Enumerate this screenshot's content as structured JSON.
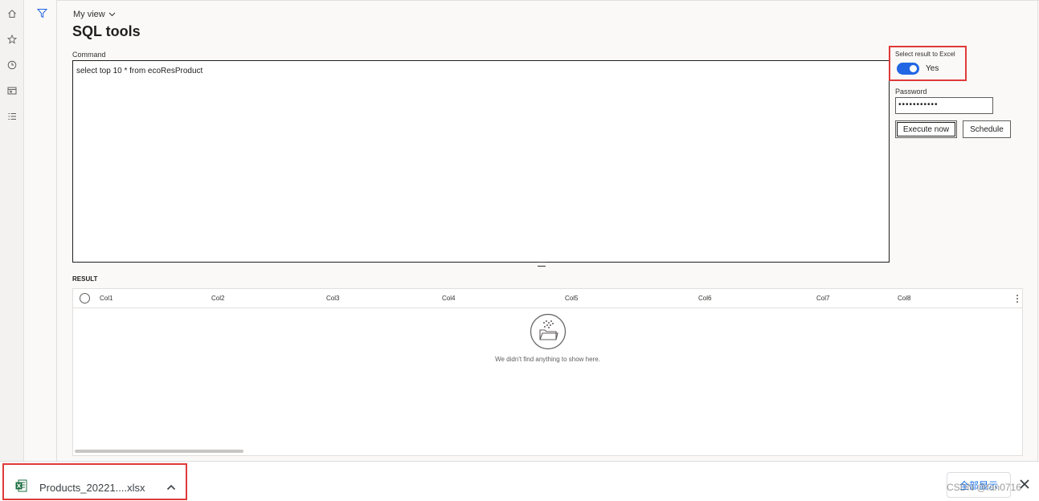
{
  "header": {
    "view_selector": "My view",
    "page_title": "SQL tools"
  },
  "command": {
    "label": "Command",
    "value": "select top 10 * from ecoResProduct"
  },
  "options": {
    "excel_label": "Select result to Excel",
    "excel_toggle_on": true,
    "excel_toggle_text": "Yes",
    "password_label": "Password",
    "password_value": "•••••••••••",
    "execute_button": "Execute now",
    "schedule_button": "Schedule"
  },
  "result": {
    "label": "RESULT",
    "columns": [
      "Col1",
      "Col2",
      "Col3",
      "Col4",
      "Col5",
      "Col6",
      "Col7",
      "Col8"
    ],
    "empty_message": "We didn't find anything to show here."
  },
  "download_bar": {
    "file_name": "Products_20221....xlsx",
    "show_all": "全部显示"
  },
  "watermark": "CSDN @fan0716",
  "colors": {
    "accent": "#2266e3",
    "highlight": "#e03a3a",
    "link": "#1a73e8",
    "excel_green": "#1d6f42"
  },
  "nav": {
    "icons": [
      "home-icon",
      "star-icon",
      "clock-icon",
      "workspace-icon",
      "list-icon"
    ]
  }
}
